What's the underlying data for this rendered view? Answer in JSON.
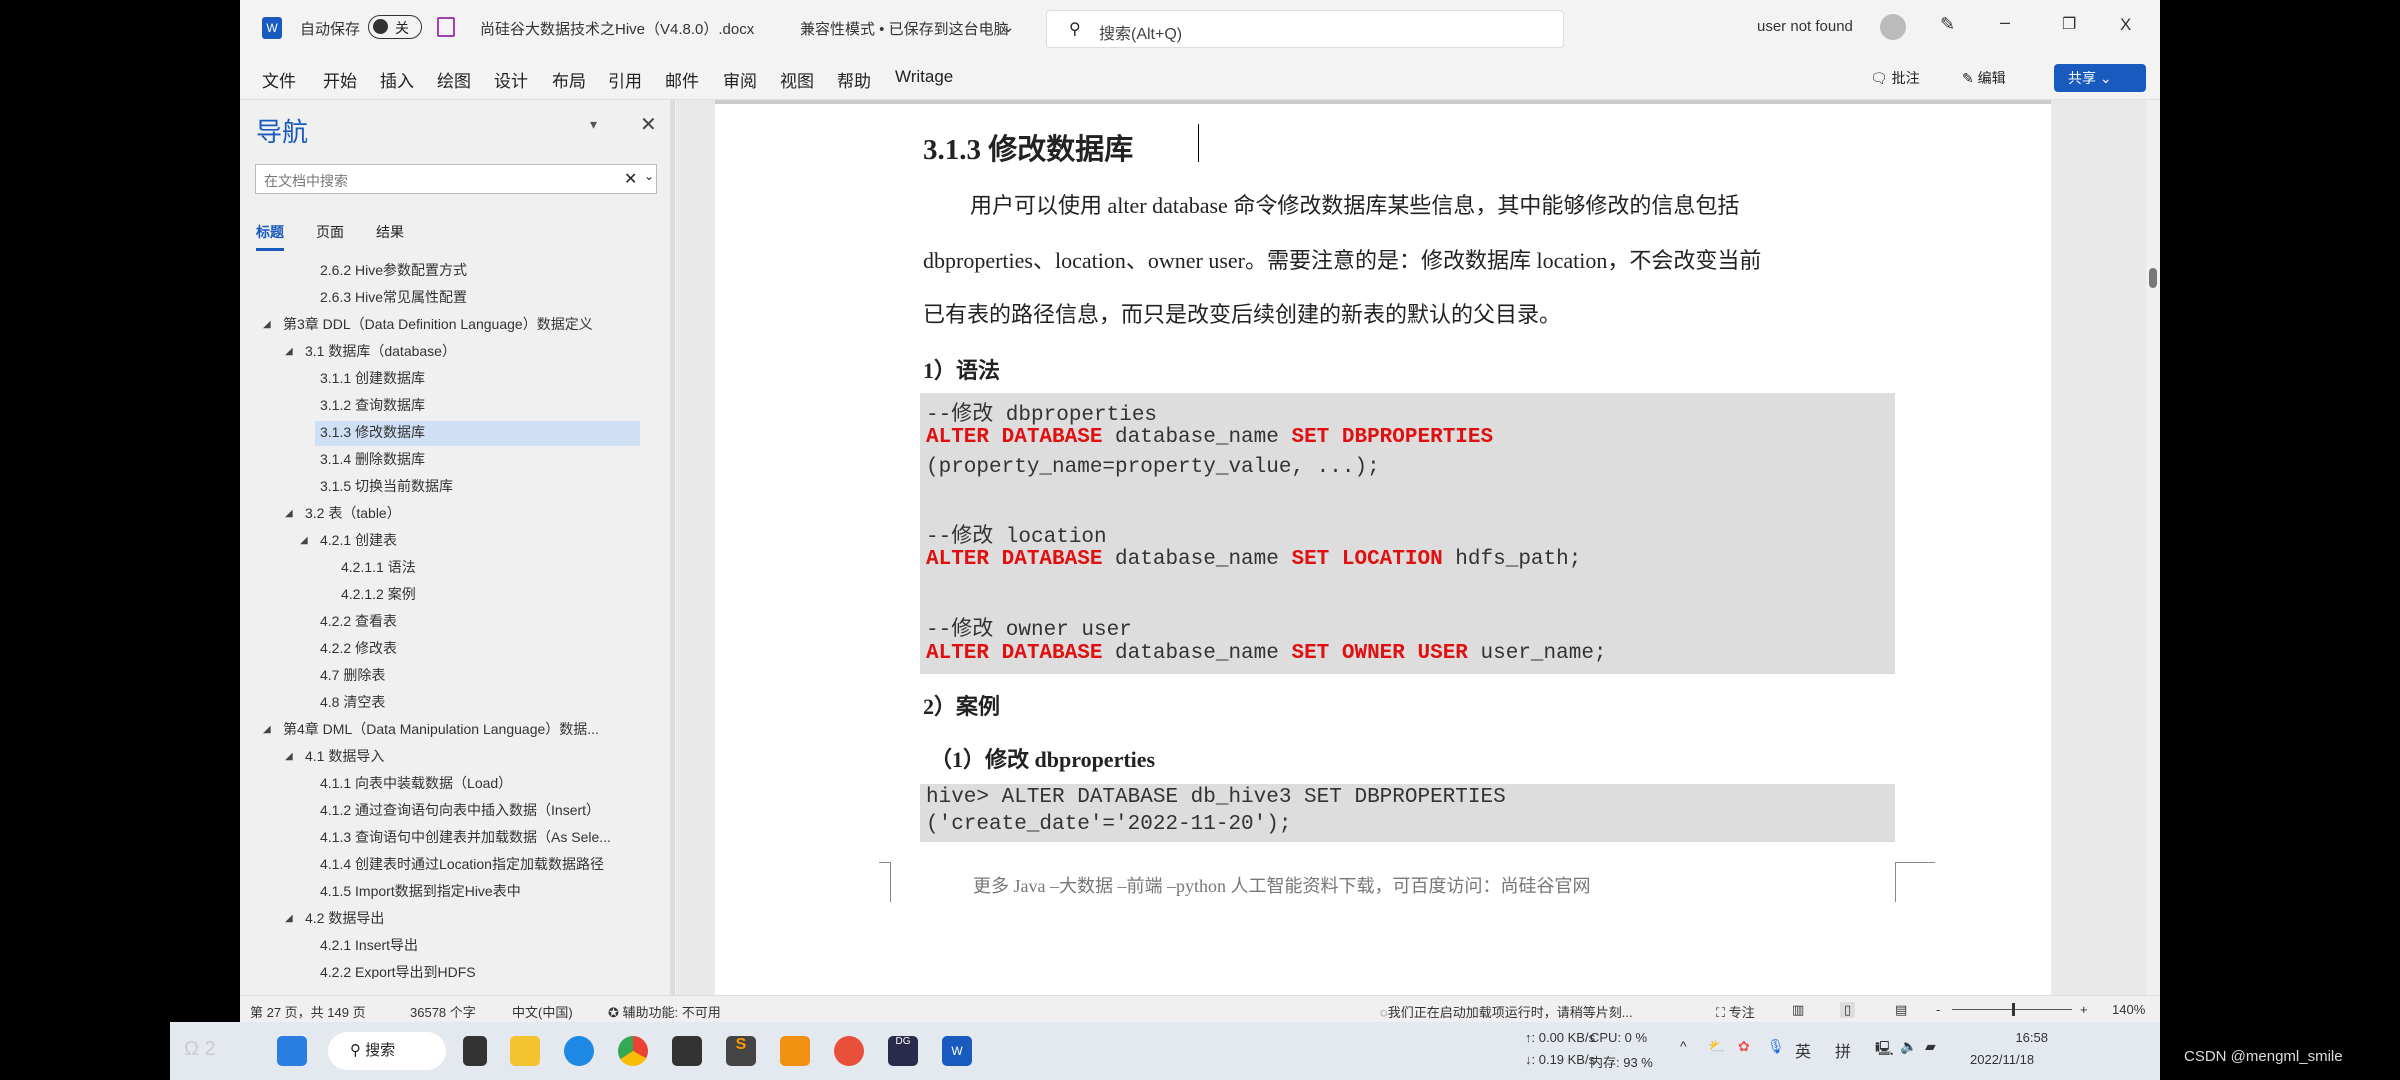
{
  "titlebar": {
    "autosave_label": "自动保存",
    "autosave_state": "关",
    "doc_title": "尚硅谷大数据技术之Hive（V4.8.0）.docx",
    "doc_status": "兼容性模式 • 已保存到这台电脑",
    "search_placeholder": "搜索(Alt+Q)",
    "user": "user not found",
    "minimize": "–",
    "close": "X"
  },
  "ribbon": {
    "tabs": [
      "文件",
      "开始",
      "插入",
      "绘图",
      "设计",
      "布局",
      "引用",
      "邮件",
      "审阅",
      "视图",
      "帮助",
      "Writage"
    ],
    "comment": "批注",
    "edit": "编辑",
    "share": "共享"
  },
  "nav": {
    "title": "导航",
    "search_placeholder": "在文档中搜索",
    "tabs": [
      "标题",
      "页面",
      "结果"
    ],
    "items": [
      {
        "label": "2.6.2 Hive参数配置方式",
        "level": 3
      },
      {
        "label": "2.6.3 Hive常见属性配置",
        "level": 3
      },
      {
        "label": "第3章 DDL（Data Definition Language）数据定义",
        "level": 1,
        "expanded": true
      },
      {
        "label": "3.1 数据库（database）",
        "level": 2,
        "expanded": true
      },
      {
        "label": "3.1.1 创建数据库",
        "level": 3
      },
      {
        "label": "3.1.2 查询数据库",
        "level": 3
      },
      {
        "label": "3.1.3 修改数据库",
        "level": 3,
        "selected": true
      },
      {
        "label": "3.1.4 删除数据库",
        "level": 3
      },
      {
        "label": "3.1.5 切换当前数据库",
        "level": 3
      },
      {
        "label": "3.2 表（table）",
        "level": 2,
        "expanded": true
      },
      {
        "label": "4.2.1 创建表",
        "level": 3,
        "expanded": true
      },
      {
        "label": "4.2.1.1 语法",
        "level": 4
      },
      {
        "label": "4.2.1.2 案例",
        "level": 4
      },
      {
        "label": "4.2.2 查看表",
        "level": 3
      },
      {
        "label": "4.2.2 修改表",
        "level": 3
      },
      {
        "label": "4.7 删除表",
        "level": 3
      },
      {
        "label": "4.8 清空表",
        "level": 3
      },
      {
        "label": "第4章 DML（Data Manipulation Language）数据...",
        "level": 1,
        "expanded": true
      },
      {
        "label": "4.1 数据导入",
        "level": 2,
        "expanded": true
      },
      {
        "label": "4.1.1 向表中装载数据（Load）",
        "level": 3
      },
      {
        "label": "4.1.2 通过查询语句向表中插入数据（Insert）",
        "level": 3
      },
      {
        "label": "4.1.3 查询语句中创建表并加载数据（As Sele...",
        "level": 3
      },
      {
        "label": "4.1.4 创建表时通过Location指定加载数据路径",
        "level": 3
      },
      {
        "label": "4.1.5 Import数据到指定Hive表中",
        "level": 3
      },
      {
        "label": "4.2 数据导出",
        "level": 2,
        "expanded": true
      },
      {
        "label": "4.2.1 Insert导出",
        "level": 3
      },
      {
        "label": "4.2.2 Export导出到HDFS",
        "level": 3
      }
    ]
  },
  "doc": {
    "heading": "3.1.3 修改数据库",
    "para": [
      "用户可以使用 alter database 命令修改数据库某些信息，其中能够修改的信息包括",
      "dbproperties、location、owner user。需要注意的是：修改数据库 location，不会改变当前",
      "已有表的路径信息，而只是改变后续创建的新表的默认的父目录。"
    ],
    "sec1": "1）语法",
    "code1": [
      [
        {
          "t": "--修改 dbproperties",
          "k": false
        }
      ],
      [
        {
          "t": "ALTER DATABASE",
          "k": true
        },
        {
          "t": " database_name ",
          "k": false
        },
        {
          "t": "SET DBPROPERTIES",
          "k": true
        }
      ],
      [
        {
          "t": "(property_name=property_value, ...);",
          "k": false
        }
      ],
      [],
      [
        {
          "t": "--修改 location",
          "k": false
        }
      ],
      [
        {
          "t": "ALTER DATABASE",
          "k": true
        },
        {
          "t": " database_name ",
          "k": false
        },
        {
          "t": "SET LOCATION",
          "k": true
        },
        {
          "t": " hdfs_path;",
          "k": false
        }
      ],
      [],
      [
        {
          "t": "--修改 owner user",
          "k": false
        }
      ],
      [
        {
          "t": "ALTER DATABASE",
          "k": true
        },
        {
          "t": " database_name ",
          "k": false
        },
        {
          "t": "SET OWNER USER",
          "k": true
        },
        {
          "t": " user_name;",
          "k": false
        }
      ]
    ],
    "sec2": "2）案例",
    "sub1": "（1）修改 dbproperties",
    "code2": [
      "hive> ALTER DATABASE db_hive3 SET DBPROPERTIES",
      "('create_date'='2022-11-20');"
    ],
    "footer": "更多 Java –大数据 –前端 –python 人工智能资料下载，可百度访问：尚硅谷官网"
  },
  "status": {
    "page": "第 27 页，共 149 页",
    "words": "36578 个字",
    "lang": "中文(中国)",
    "accessibility": "辅助功能: 不可用",
    "addin": "我们正在启动加载项运行时，请稍等片刻...",
    "focus": "专注",
    "zoom": "140%",
    "zoom_percent": 140
  },
  "taskbar": {
    "people": "2",
    "search": "搜索",
    "net_up": "↑: 0.00 KB/s",
    "net_down": "↓: 0.19 KB/s",
    "cpu": "CPU: 0 %",
    "mem": "内存: 93 %",
    "ime1": "英",
    "ime2": "拼",
    "time": "16:58",
    "date": "2022/11/18"
  },
  "watermark": "CSDN @mengml_smile",
  "colors": {
    "keyword": "#e01010",
    "word_blue": "#185abd",
    "selected": "#cfe0f5"
  }
}
